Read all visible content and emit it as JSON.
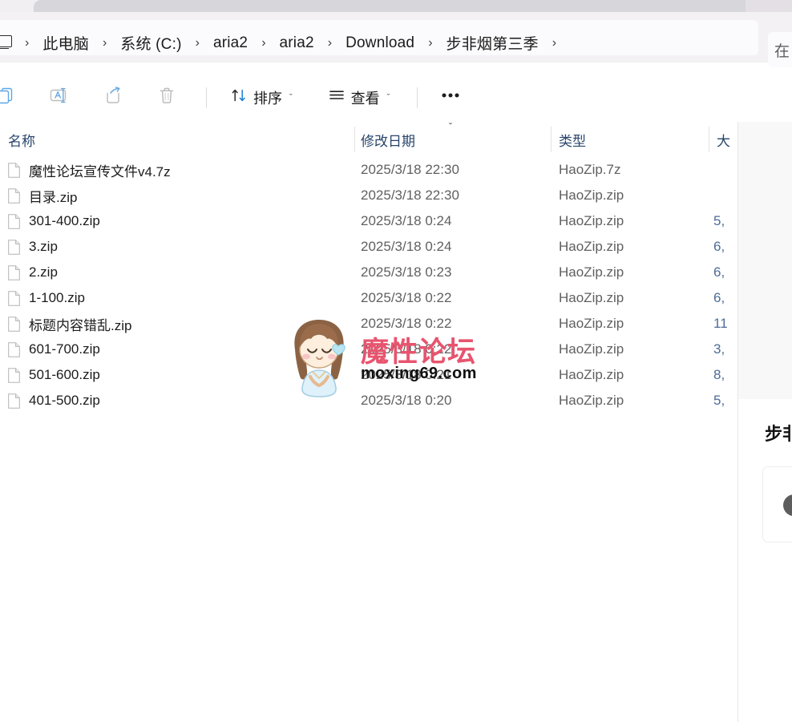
{
  "window": {
    "tab_bar": {
      "active_tab_label": ""
    }
  },
  "address_bar": {
    "computer_icon": "this-pc-icon",
    "separator": "›",
    "breadcrumbs": [
      {
        "label": "此电脑"
      },
      {
        "label": "系统 (C:)"
      },
      {
        "label": "aria2"
      },
      {
        "label": "aria2"
      },
      {
        "label": "Download"
      },
      {
        "label": "步非烟第三季"
      }
    ],
    "search": {
      "visible_text": "在",
      "placeholder": "在 步非烟第三季 中搜索"
    }
  },
  "toolbar": {
    "items": [
      {
        "name": "copy-button",
        "icon": "copy-icon",
        "label": ""
      },
      {
        "name": "rename-button",
        "icon": "rename-icon",
        "label": ""
      },
      {
        "name": "share-button",
        "icon": "share-icon",
        "label": ""
      },
      {
        "name": "delete-button",
        "icon": "trash-icon",
        "label": ""
      }
    ],
    "sort_label": "排序",
    "view_label": "查看",
    "more_label": "•••",
    "chevron": "ˇ"
  },
  "columns": [
    {
      "key": "name",
      "label": "名称"
    },
    {
      "key": "date",
      "label": "修改日期",
      "sorted": true,
      "sort_direction": "descending",
      "sort_glyph": "ˇ"
    },
    {
      "key": "type",
      "label": "类型"
    },
    {
      "key": "size",
      "label": "大"
    }
  ],
  "files": [
    {
      "icon": "file-icon",
      "name": "魔性论坛宣传文件v4.7z",
      "date": "2025/3/18 22:30",
      "type": "HaoZip.7z",
      "size": ""
    },
    {
      "icon": "file-icon",
      "name": "目录.zip",
      "date": "2025/3/18 22:30",
      "type": "HaoZip.zip",
      "size": ""
    },
    {
      "icon": "file-icon",
      "name": "301-400.zip",
      "date": "2025/3/18 0:24",
      "type": "HaoZip.zip",
      "size": "5,"
    },
    {
      "icon": "file-icon",
      "name": "3.zip",
      "date": "2025/3/18 0:24",
      "type": "HaoZip.zip",
      "size": "6,"
    },
    {
      "icon": "file-icon",
      "name": "2.zip",
      "date": "2025/3/18 0:23",
      "type": "HaoZip.zip",
      "size": "6,"
    },
    {
      "icon": "file-icon",
      "name": "1-100.zip",
      "date": "2025/3/18 0:22",
      "type": "HaoZip.zip",
      "size": "6,"
    },
    {
      "icon": "file-icon",
      "name": "标题内容错乱.zip",
      "date": "2025/3/18 0:22",
      "type": "HaoZip.zip",
      "size": "11"
    },
    {
      "icon": "file-icon",
      "name": "601-700.zip",
      "date": "2025/3/18 0:22",
      "type": "HaoZip.zip",
      "size": "3,"
    },
    {
      "icon": "file-icon",
      "name": "501-600.zip",
      "date": "2025/3/18 0:21",
      "type": "HaoZip.zip",
      "size": "8,"
    },
    {
      "icon": "file-icon",
      "name": "401-500.zip",
      "date": "2025/3/18 0:20",
      "type": "HaoZip.zip",
      "size": "5,"
    }
  ],
  "watermark": {
    "site_name_cn": "魔性论坛",
    "site_url": "moxing69.com",
    "mascot": "chibi-girl-illustration"
  },
  "details_pane": {
    "title": "步非烟第三季",
    "info_icon": "info-icon",
    "info_glyph": "i"
  },
  "colors": {
    "header_text": "#28456b",
    "accent_blue": "#4d6b99",
    "watermark_pink": "#e8546e",
    "chrome_bg": "#f3f1f4"
  }
}
